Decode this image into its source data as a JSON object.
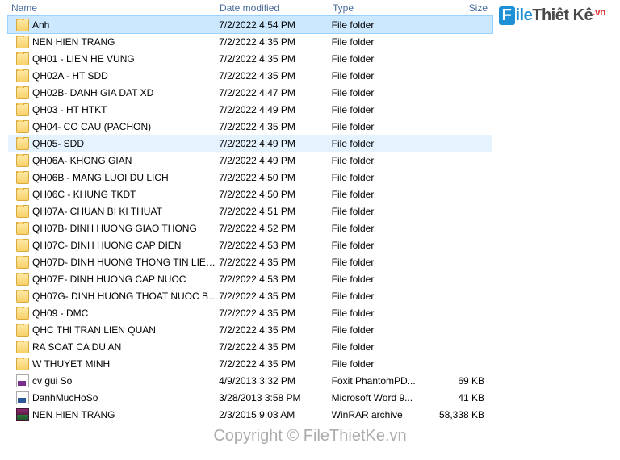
{
  "columns": {
    "name": "Name",
    "date": "Date modified",
    "type": "Type",
    "size": "Size"
  },
  "logo": {
    "f": "F",
    "ile": "ile",
    "rest": "Thiêt Kê",
    "vn": ".vn"
  },
  "watermark": "Copyright © FileThietKe.vn",
  "rows": [
    {
      "name": "Anh",
      "date": "7/2/2022 4:54 PM",
      "type": "File folder",
      "size": "",
      "icon": "folder",
      "state": "selected"
    },
    {
      "name": "NEN HIEN TRANG",
      "date": "7/2/2022 4:35 PM",
      "type": "File folder",
      "size": "",
      "icon": "folder",
      "state": ""
    },
    {
      "name": "QH01 - LIEN HE VUNG",
      "date": "7/2/2022 4:35 PM",
      "type": "File folder",
      "size": "",
      "icon": "folder",
      "state": ""
    },
    {
      "name": "QH02A -  HT SDD",
      "date": "7/2/2022 4:35 PM",
      "type": "File folder",
      "size": "",
      "icon": "folder",
      "state": ""
    },
    {
      "name": "QH02B- DANH GIA DAT XD",
      "date": "7/2/2022 4:47 PM",
      "type": "File folder",
      "size": "",
      "icon": "folder",
      "state": ""
    },
    {
      "name": "QH03 - HT HTKT",
      "date": "7/2/2022 4:49 PM",
      "type": "File folder",
      "size": "",
      "icon": "folder",
      "state": ""
    },
    {
      "name": "QH04- CO CAU (PACHON)",
      "date": "7/2/2022 4:35 PM",
      "type": "File folder",
      "size": "",
      "icon": "folder",
      "state": ""
    },
    {
      "name": "QH05-  SDD",
      "date": "7/2/2022 4:49 PM",
      "type": "File folder",
      "size": "",
      "icon": "folder",
      "state": "hover"
    },
    {
      "name": "QH06A- KHONG GIAN",
      "date": "7/2/2022 4:49 PM",
      "type": "File folder",
      "size": "",
      "icon": "folder",
      "state": ""
    },
    {
      "name": "QH06B - MANG LUOI DU LICH",
      "date": "7/2/2022 4:50 PM",
      "type": "File folder",
      "size": "",
      "icon": "folder",
      "state": ""
    },
    {
      "name": "QH06C - KHUNG TKDT",
      "date": "7/2/2022 4:50 PM",
      "type": "File folder",
      "size": "",
      "icon": "folder",
      "state": ""
    },
    {
      "name": "QH07A- CHUAN BI KI THUAT",
      "date": "7/2/2022 4:51 PM",
      "type": "File folder",
      "size": "",
      "icon": "folder",
      "state": ""
    },
    {
      "name": "QH07B- DINH HUONG GIAO THONG",
      "date": "7/2/2022 4:52 PM",
      "type": "File folder",
      "size": "",
      "icon": "folder",
      "state": ""
    },
    {
      "name": "QH07C- DINH HUONG CAP DIEN",
      "date": "7/2/2022 4:53 PM",
      "type": "File folder",
      "size": "",
      "icon": "folder",
      "state": ""
    },
    {
      "name": "QH07D-  DINH HUONG THONG TIN LIEN...",
      "date": "7/2/2022 4:35 PM",
      "type": "File folder",
      "size": "",
      "icon": "folder",
      "state": ""
    },
    {
      "name": "QH07E- DINH HUONG CAP NUOC",
      "date": "7/2/2022 4:53 PM",
      "type": "File folder",
      "size": "",
      "icon": "folder",
      "state": ""
    },
    {
      "name": "QH07G- DINH HUONG THOAT NUOC BA...",
      "date": "7/2/2022 4:35 PM",
      "type": "File folder",
      "size": "",
      "icon": "folder",
      "state": ""
    },
    {
      "name": "QH09 - DMC",
      "date": "7/2/2022 4:35 PM",
      "type": "File folder",
      "size": "",
      "icon": "folder",
      "state": ""
    },
    {
      "name": "QHC THI TRAN LIEN QUAN",
      "date": "7/2/2022 4:35 PM",
      "type": "File folder",
      "size": "",
      "icon": "folder",
      "state": ""
    },
    {
      "name": "RA SOAT CA DU AN",
      "date": "7/2/2022 4:35 PM",
      "type": "File folder",
      "size": "",
      "icon": "folder",
      "state": ""
    },
    {
      "name": "W THUYET MINH",
      "date": "7/2/2022 4:35 PM",
      "type": "File folder",
      "size": "",
      "icon": "folder",
      "state": ""
    },
    {
      "name": "cv gui So",
      "date": "4/9/2013 3:32 PM",
      "type": "Foxit PhantomPD...",
      "size": "69 KB",
      "icon": "pdf",
      "state": ""
    },
    {
      "name": "DanhMucHoSo",
      "date": "3/28/2013 3:58 PM",
      "type": "Microsoft Word 9...",
      "size": "41 KB",
      "icon": "doc",
      "state": ""
    },
    {
      "name": "NEN HIEN TRANG",
      "date": "2/3/2015 9:03 AM",
      "type": "WinRAR archive",
      "size": "58,338 KB",
      "icon": "rar",
      "state": ""
    }
  ]
}
